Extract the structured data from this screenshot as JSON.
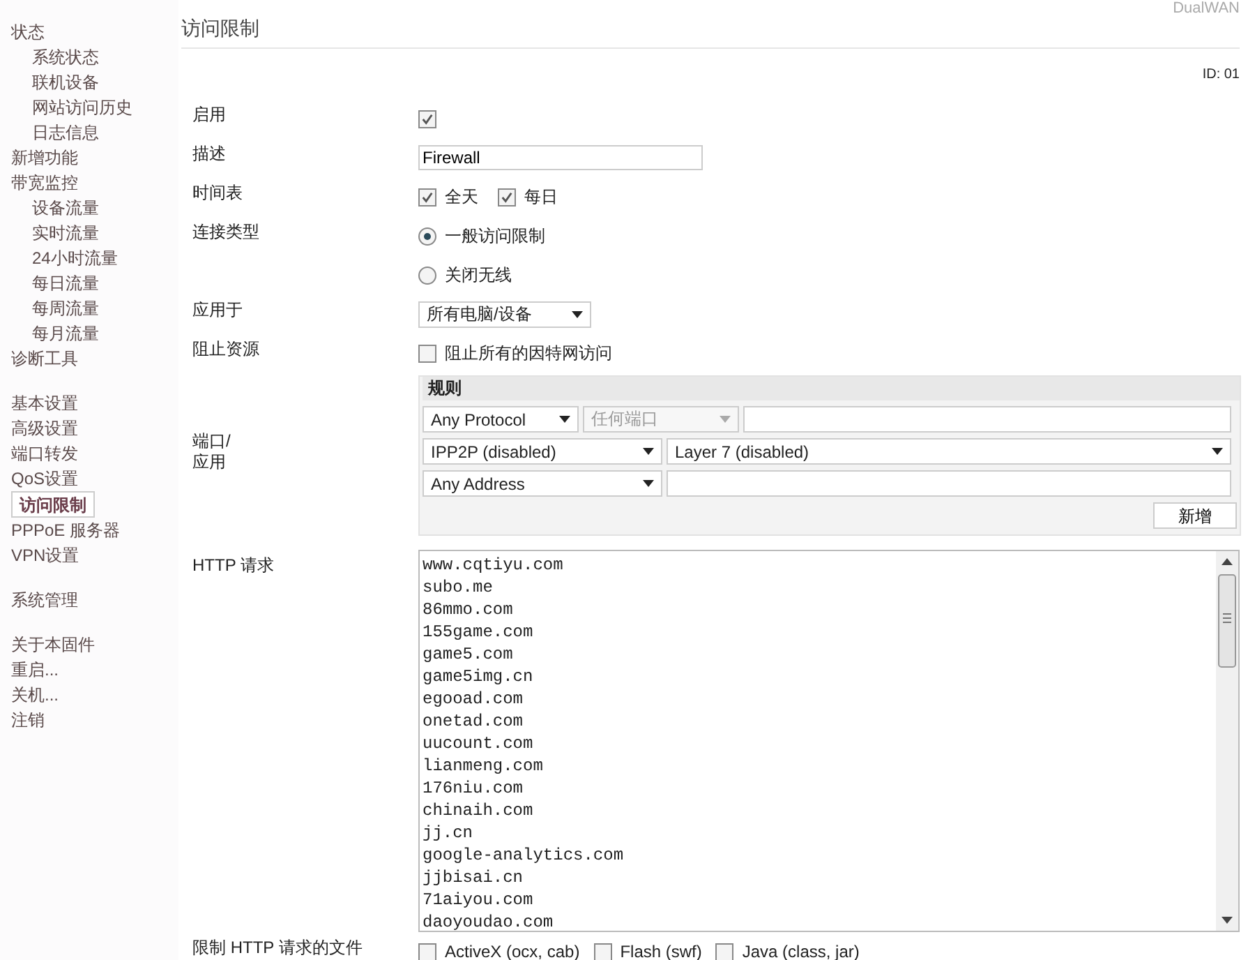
{
  "brand": "DualWAN",
  "page_title": "访问限制",
  "id_label": "ID: 01",
  "sidebar": {
    "sections": [
      [
        {
          "label": "状态",
          "selected": false,
          "children": [
            {
              "label": "系统状态",
              "selected": false
            },
            {
              "label": "联机设备",
              "selected": false
            },
            {
              "label": "网站访问历史",
              "selected": false
            },
            {
              "label": "日志信息",
              "selected": false
            }
          ]
        },
        {
          "label": "新增功能",
          "selected": false
        },
        {
          "label": "带宽监控",
          "selected": false,
          "children": [
            {
              "label": "设备流量",
              "selected": false
            },
            {
              "label": "实时流量",
              "selected": false
            },
            {
              "label": "24小时流量",
              "selected": false
            },
            {
              "label": "每日流量",
              "selected": false
            },
            {
              "label": "每周流量",
              "selected": false
            },
            {
              "label": "每月流量",
              "selected": false
            }
          ]
        },
        {
          "label": "诊断工具",
          "selected": false
        }
      ],
      [
        {
          "label": "基本设置",
          "selected": false
        },
        {
          "label": "高级设置",
          "selected": false
        },
        {
          "label": "端口转发",
          "selected": false
        },
        {
          "label": "QoS设置",
          "selected": false
        },
        {
          "label": "访问限制",
          "selected": true
        },
        {
          "label": "PPPoE 服务器",
          "selected": false
        },
        {
          "label": "VPN设置",
          "selected": false
        }
      ],
      [
        {
          "label": "系统管理",
          "selected": false
        }
      ],
      [
        {
          "label": "关于本固件",
          "selected": false
        },
        {
          "label": "重启...",
          "selected": false
        },
        {
          "label": "关机...",
          "selected": false
        },
        {
          "label": "注销",
          "selected": false
        }
      ]
    ]
  },
  "form": {
    "enable": {
      "label": "启用",
      "checked": true
    },
    "description": {
      "label": "描述",
      "value": "Firewall"
    },
    "schedule": {
      "label": "时间表",
      "options": [
        {
          "label": "全天",
          "checked": true
        },
        {
          "label": "每日",
          "checked": true
        }
      ]
    },
    "connection_type": {
      "label": "连接类型",
      "options": [
        {
          "label": "一般访问限制",
          "selected": true
        },
        {
          "label": "关闭无线",
          "selected": false
        }
      ]
    },
    "apply_to": {
      "label": "应用于",
      "value": "所有电脑/设备"
    },
    "block_resources": {
      "label": "阻止资源",
      "option": {
        "label": "阻止所有的因特网访问",
        "checked": false
      }
    },
    "port_app": {
      "label_lines": [
        "端口/",
        "应用"
      ],
      "rules": {
        "title": "规则",
        "protocol": "Any Protocol",
        "port": {
          "value": "任何端口",
          "disabled": true
        },
        "ipp2p": "IPP2P (disabled)",
        "layer7": "Layer 7 (disabled)",
        "address": "Any Address",
        "add_button": "新增"
      }
    },
    "http_request": {
      "label": "HTTP 请求",
      "entries": [
        "www.cqtiyu.com",
        "subo.me",
        "86mmo.com",
        "155game.com",
        "game5.com",
        "game5img.cn",
        "egooad.com",
        "onetad.com",
        "uucount.com",
        "lianmeng.com",
        "176niu.com",
        "chinaih.com",
        "jj.cn",
        "google-analytics.com",
        "jjbisai.cn",
        "71aiyou.com",
        "daoyoudao.com"
      ]
    },
    "file_types": {
      "label": "限制  HTTP 请求的文件",
      "options": [
        {
          "label": "ActiveX (ocx, cab)",
          "checked": false
        },
        {
          "label": "Flash (swf)",
          "checked": false
        },
        {
          "label": "Java (class, jar)",
          "checked": false
        }
      ]
    }
  }
}
